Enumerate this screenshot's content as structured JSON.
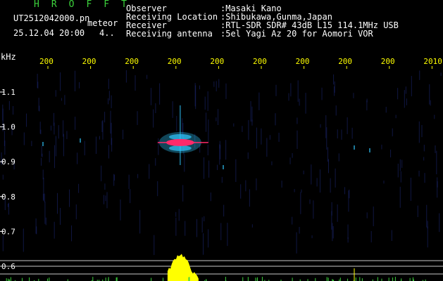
{
  "header": {
    "app_name": "HROFFT",
    "filename": "UT2512042000.pn",
    "type_label": "meteor",
    "datetime": "25.12.04 20:00",
    "small_value": "4..",
    "info_labels": [
      "Observer",
      "Receiving Location",
      "Receiver",
      "Receiving antenna"
    ],
    "info_values": [
      ":Masaki Kano",
      ":Shibukawa,Gunma,Japan",
      ":RTL-SDR SDR# 43dB L15 114.1MHz USB",
      ":5el Yagi Az 20 for Aomori VOR"
    ]
  },
  "colors": {
    "background": "#000000",
    "header_green": "#3cd23c",
    "text_white": "#ffffff",
    "axis_yellow": "#ffff00",
    "grid_blue": "#1e2a7a",
    "echo_core": "#ff2a6a",
    "echo_halo": "#30c8ff",
    "histogram": "#ffff00"
  },
  "chart_data": {
    "type": "heatmap",
    "ylabel": "kHz",
    "y_ticks": [
      "1.1",
      "1.0",
      "0.9",
      "0.8",
      "0.7",
      "0.6"
    ],
    "x_ticks": [
      "200",
      "200",
      "200",
      "200",
      "200",
      "200",
      "200",
      "200",
      "200",
      "2010"
    ],
    "echo": {
      "x_index": 3.1,
      "freq_khz": 0.955
    },
    "histogram_peak": {
      "x_index": 3.1
    }
  }
}
